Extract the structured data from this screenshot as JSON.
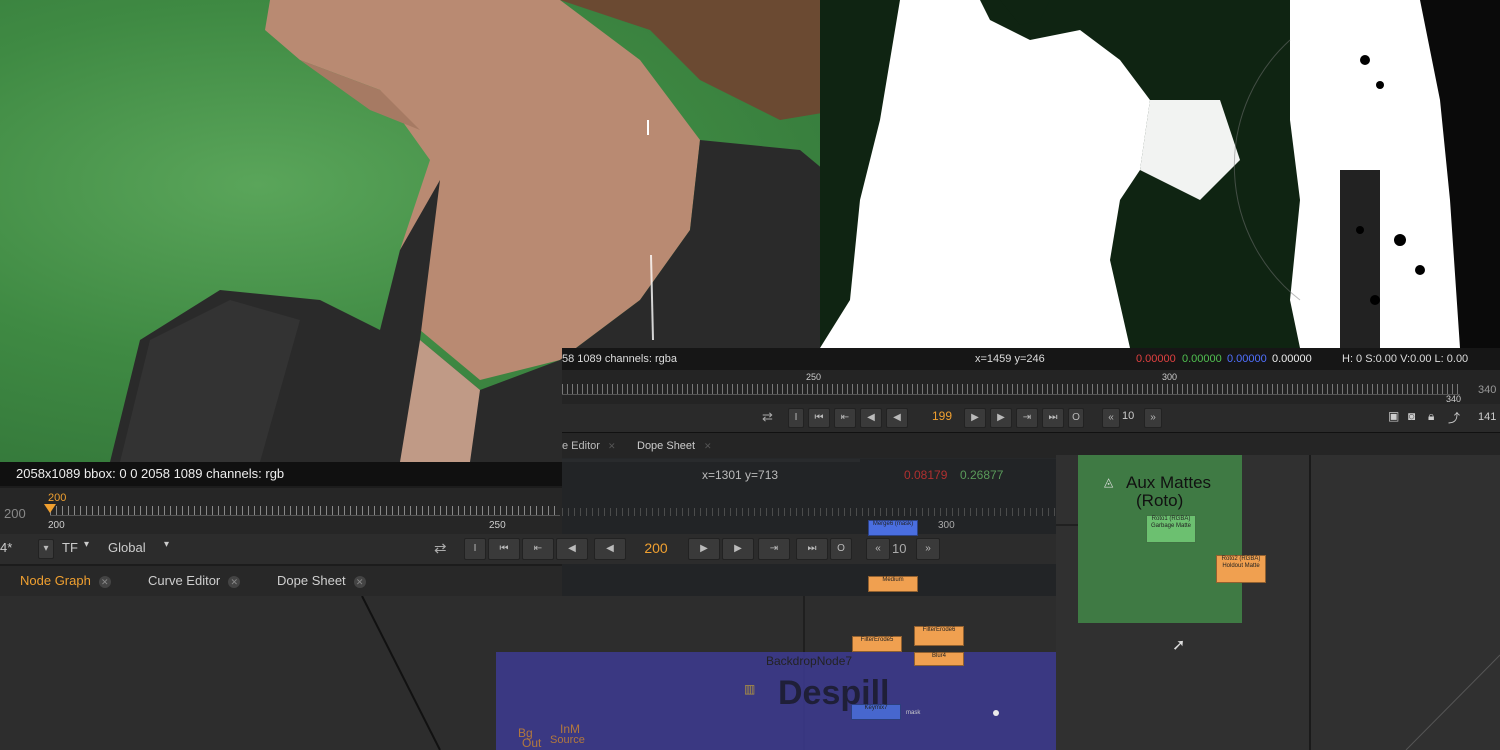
{
  "viewer_top": {
    "info_left": "58 1089 channels: rgba",
    "coords": "x=1459 y=246",
    "pixel_r": "0.00000",
    "pixel_g": "0.00000",
    "pixel_b": "0.00000",
    "pixel_a": "0.00000",
    "hsv": "H: 0 S:0.00 V:0.00  L: 0.00",
    "ruler_labels": [
      "250",
      "300",
      "340"
    ],
    "ruler_end": "340",
    "frame": "199",
    "skip_count": "10",
    "end_frame": "141"
  },
  "viewer_top_tabs": {
    "curve_editor": "e Editor",
    "dope_sheet": "Dope Sheet"
  },
  "viewer_main": {
    "info": "2058x1089  bbox: 0 0 2058 1089 channels: rgb",
    "ruler_current": "200",
    "ruler_left": "200",
    "ruler_start_label": "200",
    "ruler_mid_label": "250",
    "ghost_coords": "x=1301 y=713",
    "ghost_r": "0.08179",
    "ghost_g": "0.26877",
    "ghost_tick": "300",
    "fps_value": "4*",
    "tf_label": "TF",
    "global_label": "Global",
    "frame": "200",
    "skip_count": "10"
  },
  "panel_tabs": {
    "node_graph": "Node Graph",
    "curve_editor": "Curve Editor",
    "dope_sheet": "Dope Sheet"
  },
  "nodes": {
    "merge_mask": "Merge6 (mask)",
    "medium": "Medium",
    "filter_erode_a": "FilterErode6",
    "filter_erode_b": "FilterErode5",
    "blur": "Blur4",
    "backdrop": "BackdropNode7",
    "despill": "Despill",
    "keymix": "Keymix7",
    "mask_label": "mask",
    "inm": "InM",
    "source": "Source",
    "bg": "Bg",
    "out": "Out"
  },
  "right_panel": {
    "backdrop_title": "Aux Mattes",
    "backdrop_subtitle": "(Roto)",
    "roto1": "Roto1 (RGBA) Garbage Matte",
    "roto2": "Roto2 (RGBA) Holdout Matte"
  },
  "colors": {
    "accent_orange": "#f0a030",
    "node_orange": "#f0a050",
    "node_blue": "#4a6ee0",
    "node_green": "#6cc070",
    "backdrop_purple": "#3c3a8c",
    "backdrop_green": "#3f7a44"
  }
}
